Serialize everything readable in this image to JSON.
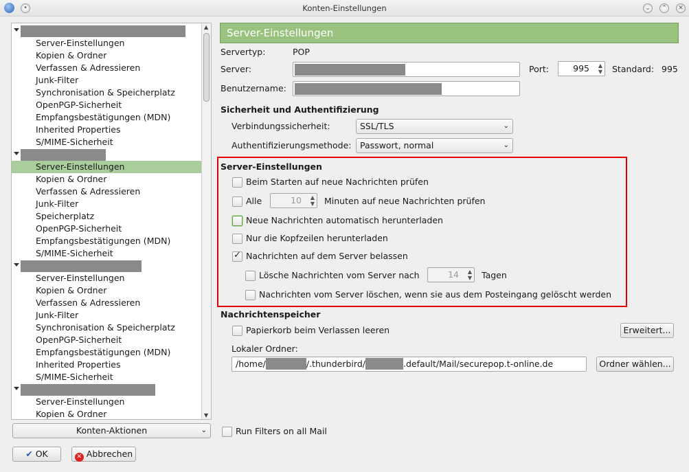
{
  "window": {
    "title": "Konten-Einstellungen"
  },
  "tree": {
    "accounts": [
      {
        "items": [
          "Server-Einstellungen",
          "Kopien & Ordner",
          "Verfassen & Adressieren",
          "Junk-Filter",
          "Synchronisation & Speicherplatz",
          "OpenPGP-Sicherheit",
          "Empfangsbestätigungen (MDN)",
          "Inherited Properties",
          "S/MIME-Sicherheit"
        ]
      },
      {
        "items": [
          "Server-Einstellungen",
          "Kopien & Ordner",
          "Verfassen & Adressieren",
          "Junk-Filter",
          "Speicherplatz",
          "OpenPGP-Sicherheit",
          "Empfangsbestätigungen (MDN)",
          "S/MIME-Sicherheit"
        ]
      },
      {
        "items": [
          "Server-Einstellungen",
          "Kopien & Ordner",
          "Verfassen & Adressieren",
          "Junk-Filter",
          "Synchronisation & Speicherplatz",
          "OpenPGP-Sicherheit",
          "Empfangsbestätigungen (MDN)",
          "Inherited Properties",
          "S/MIME-Sicherheit"
        ]
      },
      {
        "items": [
          "Server-Einstellungen",
          "Kopien & Ordner"
        ]
      }
    ],
    "selected": "Server-Einstellungen"
  },
  "buttons": {
    "account_actions": "Konten-Aktionen",
    "ok": "OK",
    "cancel": "Abbrechen",
    "advanced": "Erweitert...",
    "choose_folder": "Ordner wählen..."
  },
  "panel": {
    "header": "Server-Einstellungen",
    "server_type_label": "Servertyp:",
    "server_type_value": "POP",
    "server_label": "Server:",
    "port_label": "Port:",
    "port_value": "995",
    "default_label": "Standard:",
    "default_value": "995",
    "username_label": "Benutzername:",
    "security_heading": "Sicherheit und Authentifizierung",
    "conn_security_label": "Verbindungssicherheit:",
    "conn_security_value": "SSL/TLS",
    "auth_label": "Authentifizierungsmethode:",
    "auth_value": "Passwort, normal",
    "server_settings_heading": "Server-Einstellungen",
    "check_on_start": "Beim Starten auf neue Nachrichten prüfen",
    "check_every": "Alle",
    "check_every_value": "10",
    "check_every_suffix": "Minuten auf neue Nachrichten prüfen",
    "auto_download": "Neue Nachrichten automatisch herunterladen",
    "headers_only": "Nur die Kopfzeilen herunterladen",
    "leave_on_server": "Nachrichten auf dem Server belassen",
    "delete_after": "Lösche Nachrichten vom Server nach",
    "delete_after_value": "14",
    "delete_after_suffix": "Tagen",
    "delete_when_deleted": "Nachrichten vom Server löschen, wenn sie aus dem Posteingang gelöscht werden",
    "storage_heading": "Nachrichtenspeicher",
    "empty_trash": "Papierkorb beim Verlassen leeren",
    "local_folder_label": "Lokaler Ordner:",
    "local_folder_prefix": "/home/",
    "local_folder_mid": "/.thunderbird/",
    "local_folder_suffix": ".default/Mail/securepop.t-online.de",
    "run_filters": "Run Filters on all Mail"
  }
}
